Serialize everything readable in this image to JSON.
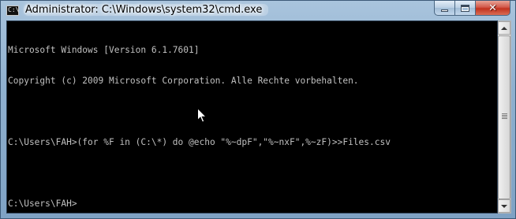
{
  "window": {
    "title": "Administrator: C:\\Windows\\system32\\cmd.exe",
    "icon": "cmd-console-icon",
    "icon_glyph": "C:\\"
  },
  "caption_buttons": {
    "minimize": "minimize-icon",
    "maximize": "maximize-icon",
    "close": "close-icon",
    "close_glyph": "✕"
  },
  "console": {
    "lines": [
      "Microsoft Windows [Version 6.1.7601]",
      "Copyright (c) 2009 Microsoft Corporation. Alle Rechte vorbehalten.",
      "",
      "C:\\Users\\FAH>(for %F in (C:\\*) do @echo \"%~dpF\",\"%~nxF\",%~zF)>>Files.csv",
      "",
      "C:\\Users\\FAH>"
    ]
  },
  "scrollbar": {
    "up_icon": "scroll-up-arrow-icon",
    "down_icon": "scroll-down-arrow-icon"
  },
  "colors": {
    "console_background": "#000000",
    "console_text": "#c0c0c0",
    "close_button": "#c2321e",
    "frame": "#8fb0cf"
  }
}
